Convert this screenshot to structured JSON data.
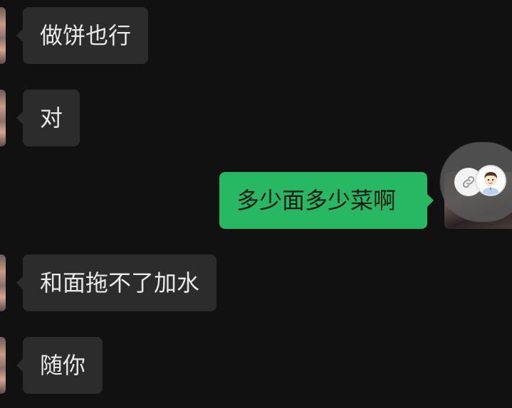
{
  "messages": [
    {
      "side": "in",
      "text": "做饼也行"
    },
    {
      "side": "in",
      "text": "对"
    },
    {
      "side": "out",
      "text": "多少面多少菜啊"
    },
    {
      "side": "in",
      "text": "和面拖不了加水"
    },
    {
      "side": "in",
      "text": "随你"
    }
  ],
  "colors": {
    "background": "#111111",
    "incoming_bubble": "#2c2c2c",
    "outgoing_bubble": "#28b864"
  },
  "icons": {
    "floating_link": "link-icon",
    "floating_avatar": "cartoon-boy-avatar"
  }
}
